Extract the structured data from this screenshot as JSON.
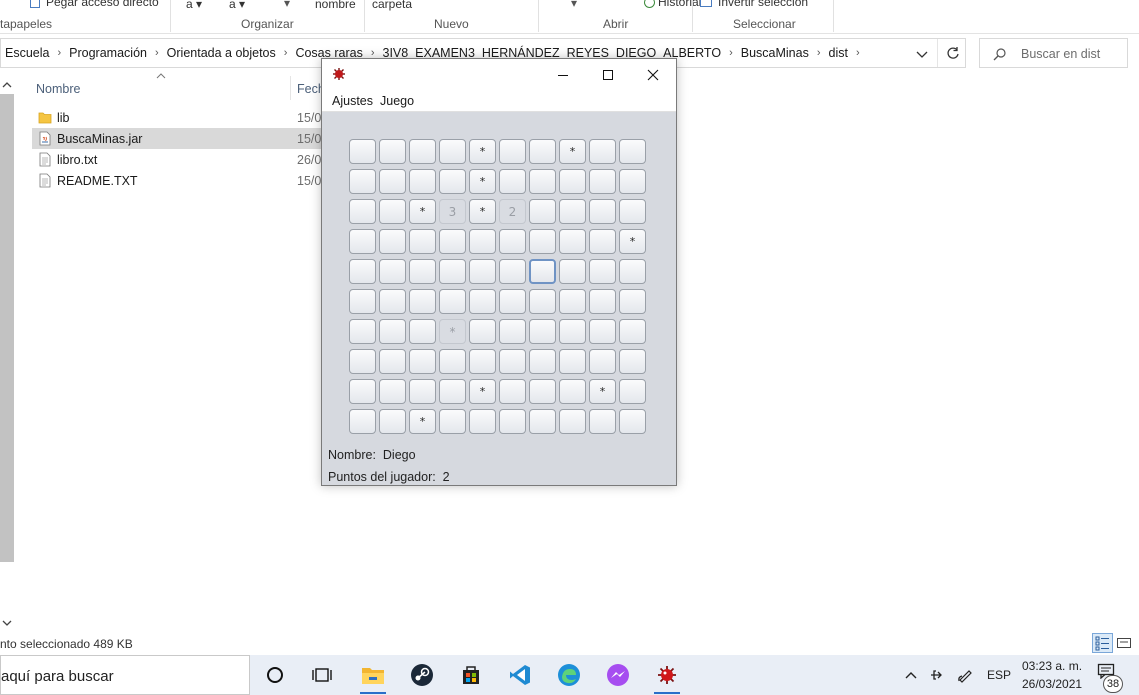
{
  "ribbon": {
    "paste_shortcut": "Pegar acceso directo",
    "font_a1": "a",
    "font_a2": "a",
    "nombre": "nombre",
    "carpeta": "carpeta",
    "historial": "Historial",
    "invertir": "Invertir selección",
    "groups": {
      "portapapeles": "tapapeles",
      "organizar": "Organizar",
      "nuevo": "Nuevo",
      "abrir": "Abrir",
      "seleccionar": "Seleccionar"
    }
  },
  "address": {
    "crumbs": [
      "Escuela",
      "Programación",
      "Orientada a objetos",
      "Cosas raras",
      "3IV8_EXAMEN3_HERNÁNDEZ_REYES_DIEGO_ALBERTO",
      "BuscaMinas",
      "dist"
    ]
  },
  "search": {
    "placeholder": "Buscar en dist"
  },
  "file_list": {
    "col_name": "Nombre",
    "col_date": "Fech",
    "files": [
      {
        "name": "lib",
        "date": "15/0",
        "type": "folder-icon"
      },
      {
        "name": "BuscaMinas.jar",
        "date": "15/0",
        "type": "jar-file-icon"
      },
      {
        "name": "libro.txt",
        "date": "26/0",
        "type": "text-file-icon"
      },
      {
        "name": "README.TXT",
        "date": "15/0",
        "type": "text-file-icon"
      }
    ]
  },
  "status": {
    "text": "nto seleccionado  489 KB"
  },
  "taskbar": {
    "search_text": "aquí para buscar",
    "lang": "ESP",
    "time": "03:23 a. m.",
    "date": "26/03/2021",
    "notification_count": "38",
    "apps": [
      "cortana-icon",
      "task-view-icon",
      "file-explorer-icon",
      "steam-icon",
      "store-icon",
      "vscode-icon",
      "edge-icon",
      "messenger-icon",
      "buscaminas-icon"
    ]
  },
  "game": {
    "menu": [
      "Ajustes",
      "Juego"
    ],
    "board": [
      [
        "",
        "",
        "",
        "",
        "*",
        "",
        "",
        "*",
        "",
        ""
      ],
      [
        "",
        "",
        "",
        "",
        "*",
        "",
        "",
        "",
        "",
        ""
      ],
      [
        "",
        "",
        "*",
        "3",
        "*",
        "2",
        "",
        "",
        "",
        ""
      ],
      [
        "",
        "",
        "",
        "",
        "",
        "",
        "",
        "",
        "",
        "*"
      ],
      [
        "",
        "",
        "",
        "",
        "",
        "",
        "",
        "",
        "",
        ""
      ],
      [
        "",
        "",
        "",
        "",
        "",
        "",
        "",
        "",
        "",
        ""
      ],
      [
        "",
        "",
        "",
        "*",
        "",
        "",
        "",
        "",
        "",
        ""
      ],
      [
        "",
        "",
        "",
        "",
        "",
        "",
        "",
        "",
        "",
        ""
      ],
      [
        "",
        "",
        "",
        "",
        "*",
        "",
        "",
        "",
        "*",
        ""
      ],
      [
        "",
        "",
        "*",
        "",
        "",
        "",
        "",
        "",
        "",
        ""
      ]
    ],
    "revealed": [
      [
        2,
        3
      ],
      [
        2,
        5
      ],
      [
        6,
        3
      ]
    ],
    "focused": [
      4,
      6
    ],
    "player_label": "Nombre:",
    "player_name": "Diego",
    "points_label": "Puntos del jugador:",
    "points_value": "2"
  }
}
